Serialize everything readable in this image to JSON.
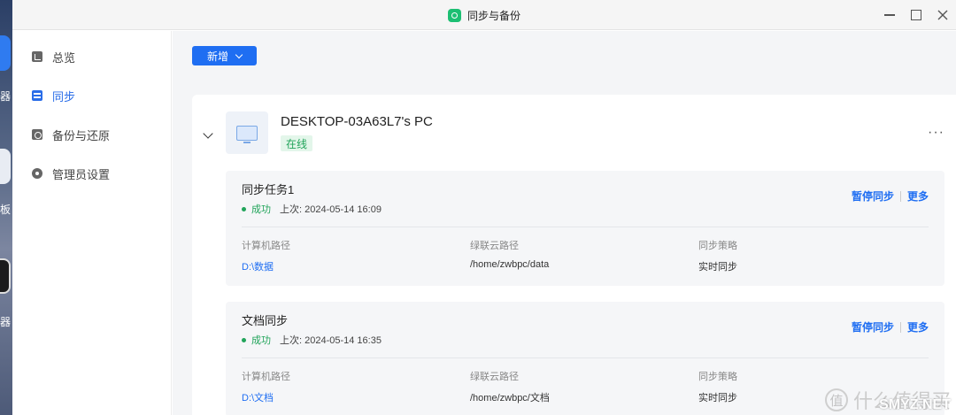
{
  "desktop": {
    "labels": [
      "器",
      "板",
      "器"
    ]
  },
  "window": {
    "title": "同步与备份"
  },
  "sidebar": {
    "items": [
      {
        "label": "总览",
        "icon": "overview-icon",
        "active": false
      },
      {
        "label": "同步",
        "icon": "sync-icon",
        "active": true
      },
      {
        "label": "备份与还原",
        "icon": "backup-icon",
        "active": false
      },
      {
        "label": "管理员设置",
        "icon": "admin-settings-icon",
        "active": false
      }
    ]
  },
  "toolbar": {
    "new_label": "新增"
  },
  "device": {
    "name": "DESKTOP-03A63L7's PC",
    "status": "在线",
    "more": "···"
  },
  "tasks": [
    {
      "name": "同步任务1",
      "status": "成功",
      "last_run": "上次: 2024-05-14 16:09",
      "pause_label": "暂停同步",
      "more_label": "更多",
      "computer_path_label": "计算机路径",
      "computer_path": "D:\\数据",
      "cloud_path_label": "绿联云路径",
      "cloud_path": "/home/zwbpc/data",
      "policy_label": "同步策略",
      "policy": "实时同步"
    },
    {
      "name": "文档同步",
      "status": "成功",
      "last_run": "上次: 2024-05-14 16:35",
      "pause_label": "暂停同步",
      "more_label": "更多",
      "computer_path_label": "计算机路径",
      "computer_path": "D:\\文档",
      "cloud_path_label": "绿联云路径",
      "cloud_path": "/home/zwbpc/文档",
      "policy_label": "同步策略",
      "policy": "实时同步"
    }
  ],
  "watermark": {
    "glyph": "值",
    "text": "什么值得买",
    "sub": "SMYZ.NET"
  },
  "colors": {
    "accent": "#1f6ef2",
    "success": "#21a45a",
    "app_icon": "#1dbf73"
  }
}
